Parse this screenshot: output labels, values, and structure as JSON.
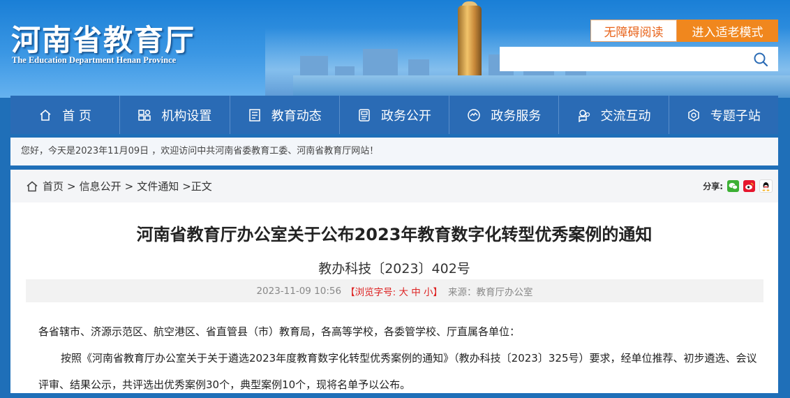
{
  "header": {
    "title": "河南省教育厅",
    "subtitle": "The Education Department Henan Province",
    "accessible_label": "无障碍阅读",
    "elder_mode_label": "进入适老模式",
    "search": {
      "value": "",
      "placeholder": ""
    }
  },
  "nav": {
    "items": [
      {
        "label": "首 页",
        "icon": "home-icon"
      },
      {
        "label": "机构设置",
        "icon": "org-icon"
      },
      {
        "label": "教育动态",
        "icon": "news-icon"
      },
      {
        "label": "政务公开",
        "icon": "document-icon"
      },
      {
        "label": "政务服务",
        "icon": "service-icon"
      },
      {
        "label": "交流互动",
        "icon": "interaction-icon"
      },
      {
        "label": "专题子站",
        "icon": "topic-icon"
      }
    ]
  },
  "greeting": "您好，今天是2023年11月09日 ，欢迎访问中共河南省委教育工委、河南省教育厅网站！",
  "breadcrumb": {
    "items": [
      "首页",
      "信息公开",
      "文件通知"
    ],
    "current": "正文",
    "separator": ">"
  },
  "share": {
    "label": "分享:",
    "targets": [
      "wechat-icon",
      "weibo-icon",
      "qq-icon"
    ]
  },
  "article": {
    "title": "河南省教育厅办公室关于公布2023年教育数字化转型优秀案例的通知",
    "doc_number": "教办科技〔2023〕402号",
    "date": "2023-11-09 10:56",
    "font_size_prefix": "【浏览字号:",
    "font_sizes": [
      "大",
      "中",
      "小"
    ],
    "font_size_suffix": "】",
    "source": "来源：教育厅办公室",
    "recipients": "各省辖市、济源示范区、航空港区、省直管县（市）教育局，各高等学校，各委管学校、厅直属各单位：",
    "paragraph_1": "按照《河南省教育厅办公室关于关于遴选2023年度教育数字化转型优秀案例的通知》（教办科技〔2023〕325号）要求，经单位推荐、初步遴选、会议评审、结果公示，共评选出优秀案例30个，典型案例10个，现将名单予以公布。"
  },
  "colors": {
    "nav_bg": "#2a6bb5",
    "accent_orange": "#f0871e",
    "font_size_red": "#d22222"
  }
}
